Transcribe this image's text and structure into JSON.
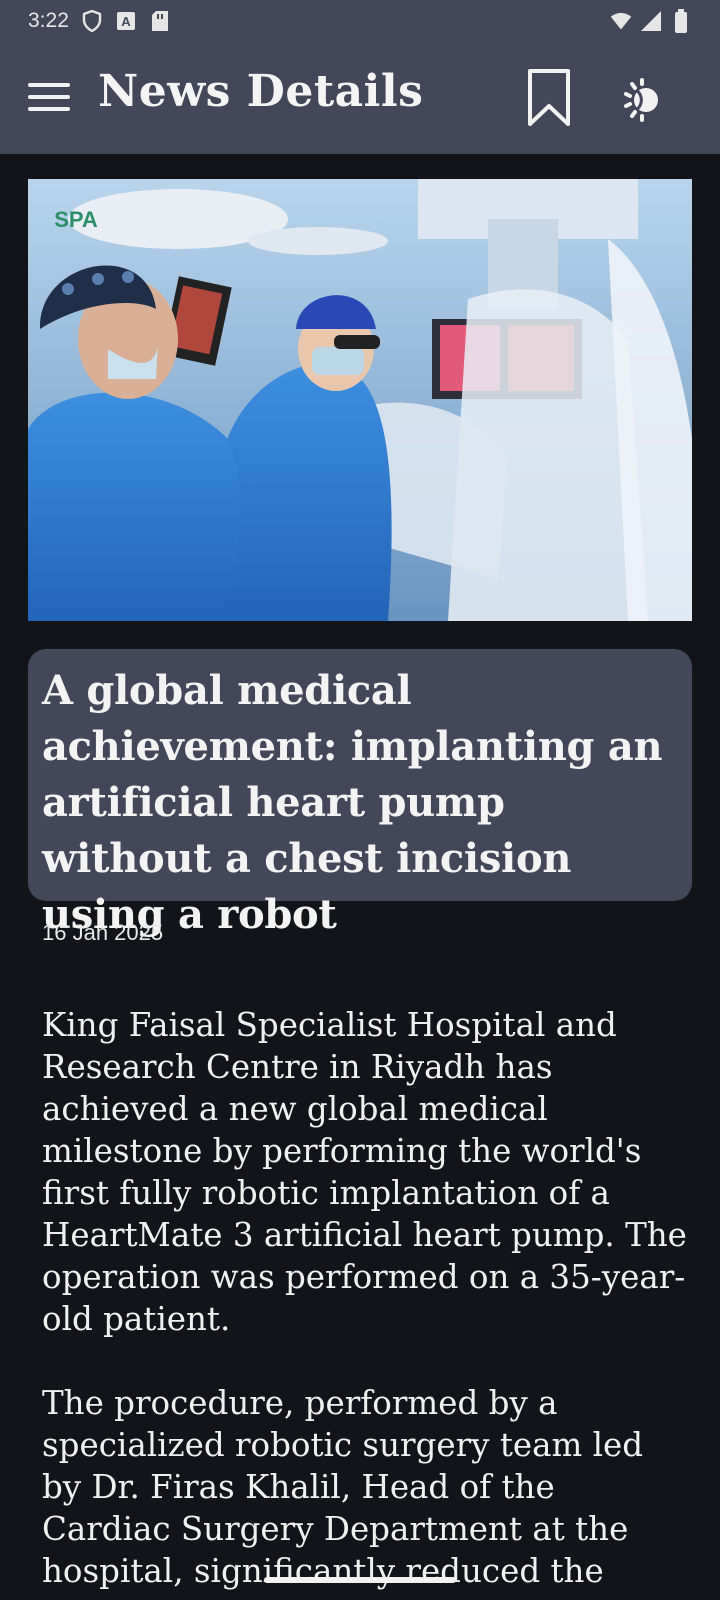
{
  "status_bar": {
    "time": "3:22",
    "icons_left": [
      "shield-icon",
      "a-notification-icon",
      "sim-card-icon"
    ],
    "icons_right": [
      "wifi-icon",
      "signal-icon",
      "battery-icon"
    ]
  },
  "app_bar": {
    "title": "News Details",
    "menu_icon": "hamburger-menu-icon",
    "bookmark_icon": "bookmark-icon",
    "theme_icon": "theme-toggle-icon"
  },
  "hero_image": {
    "watermark": "SPA",
    "description_icon": "surgery-photo"
  },
  "article": {
    "headline": "A global medical achievement: implanting an artificial heart pump without a chest incision using a robot",
    "date": "16 Jan 2025",
    "paragraphs": [
      "King Faisal Specialist Hospital and Research Centre in Riyadh has achieved a new global medical milestone by performing the world's first fully robotic implantation of a HeartMate 3 artificial heart pump. The operation was performed on a 35-year-old patient.",
      "The procedure, performed by a specialized robotic surgery team led by Dr. Firas Khalil, Head of the Cardiac Surgery Department at the hospital, significantly reduced the"
    ]
  },
  "colors": {
    "bar_background": "#44475a",
    "page_background": "#131419",
    "text": "#f0f0f0"
  }
}
